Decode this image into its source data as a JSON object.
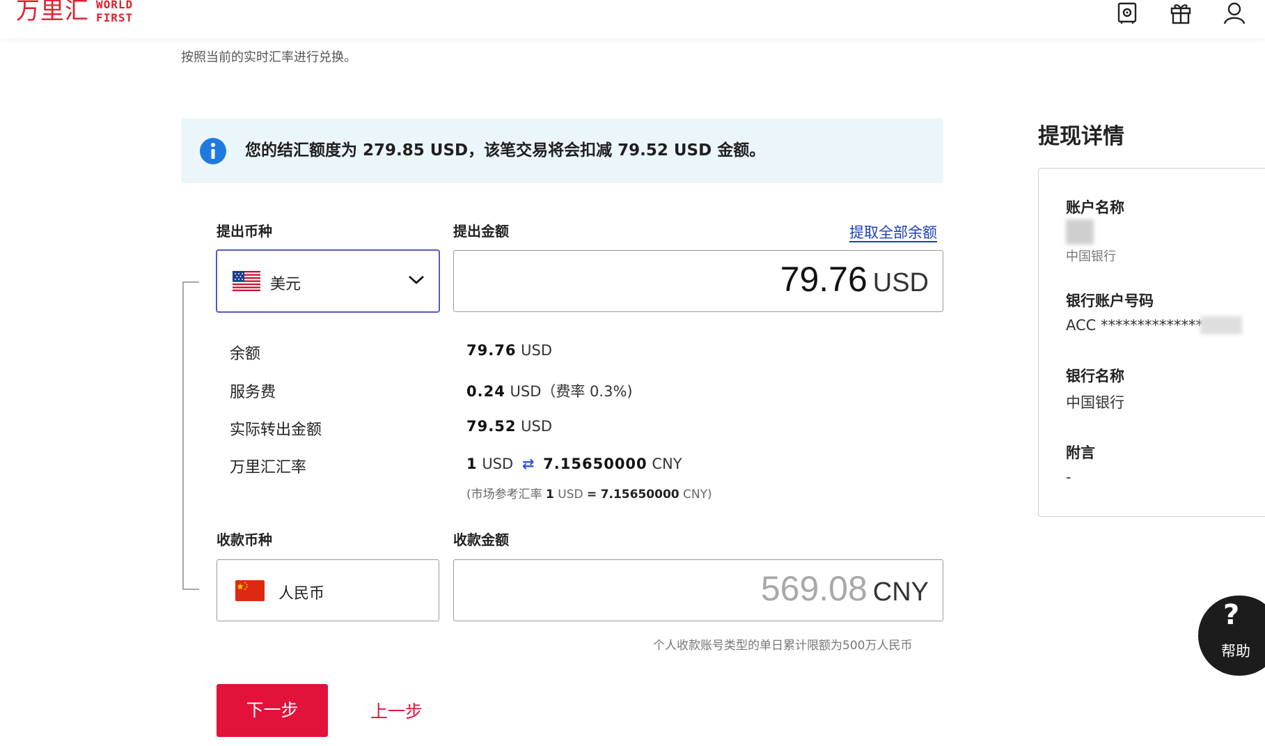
{
  "header": {
    "logo_cn": "万里汇",
    "logo_en_1": "WORLD",
    "logo_en_2": "FIRST",
    "icons": [
      "safe-icon",
      "gift-icon",
      "user-icon"
    ]
  },
  "subtitle": "按照当前的实时汇率进行兑换。",
  "notice": {
    "text": "您的结汇额度为 279.85 USD，该笔交易将会扣减 79.52 USD 金额。"
  },
  "withdraw": {
    "currency_label": "提出币种",
    "currency_value": "美元",
    "amount_label": "提出金额",
    "withdraw_all_link": "提取全部余额",
    "amount_value": "79.76",
    "amount_currency": "USD"
  },
  "details": {
    "balance_label": "余额",
    "balance_value": "79.76",
    "balance_unit": "USD",
    "fee_label": "服务费",
    "fee_value": "0.24",
    "fee_unit": "USD（费率 0.3%)",
    "actual_label": "实际转出金额",
    "actual_value": "79.52",
    "actual_unit": "USD",
    "rate_label": "万里汇汇率",
    "rate_from_num": "1",
    "rate_from_cur": "USD",
    "rate_to_num": "7.15650000",
    "rate_to_cur": "CNY",
    "market_prefix": "(市场参考汇率",
    "market_from_num": "1",
    "market_from_cur": "USD",
    "market_eq": "=",
    "market_to_num": "7.15650000",
    "market_to_cur": "CNY)"
  },
  "receive": {
    "currency_label": "收款币种",
    "currency_value": "人民币",
    "amount_label": "收款金额",
    "amount_value": "569.08",
    "amount_currency": "CNY",
    "limit_note": "个人收款账号类型的单日累计限额为500万人民币"
  },
  "buttons": {
    "next": "下一步",
    "prev": "上一步"
  },
  "sidebar": {
    "title": "提现详情",
    "account_name_label": "账户名称",
    "account_bank_sub": "中国银行",
    "account_number_label": "银行账户号码",
    "account_number_value": "ACC **************",
    "bank_name_label": "银行名称",
    "bank_name_value": "中国银行",
    "note_label": "附言",
    "note_value": "-"
  },
  "help": {
    "symbol": "?",
    "label": "帮助"
  },
  "colors": {
    "brand_red": "#e0202e",
    "button_red": "#e3123a",
    "link_blue": "#1c3fb8",
    "info_blue": "#1f7ae0",
    "notice_bg": "#ebf6fb",
    "select_border": "#5557c9"
  }
}
